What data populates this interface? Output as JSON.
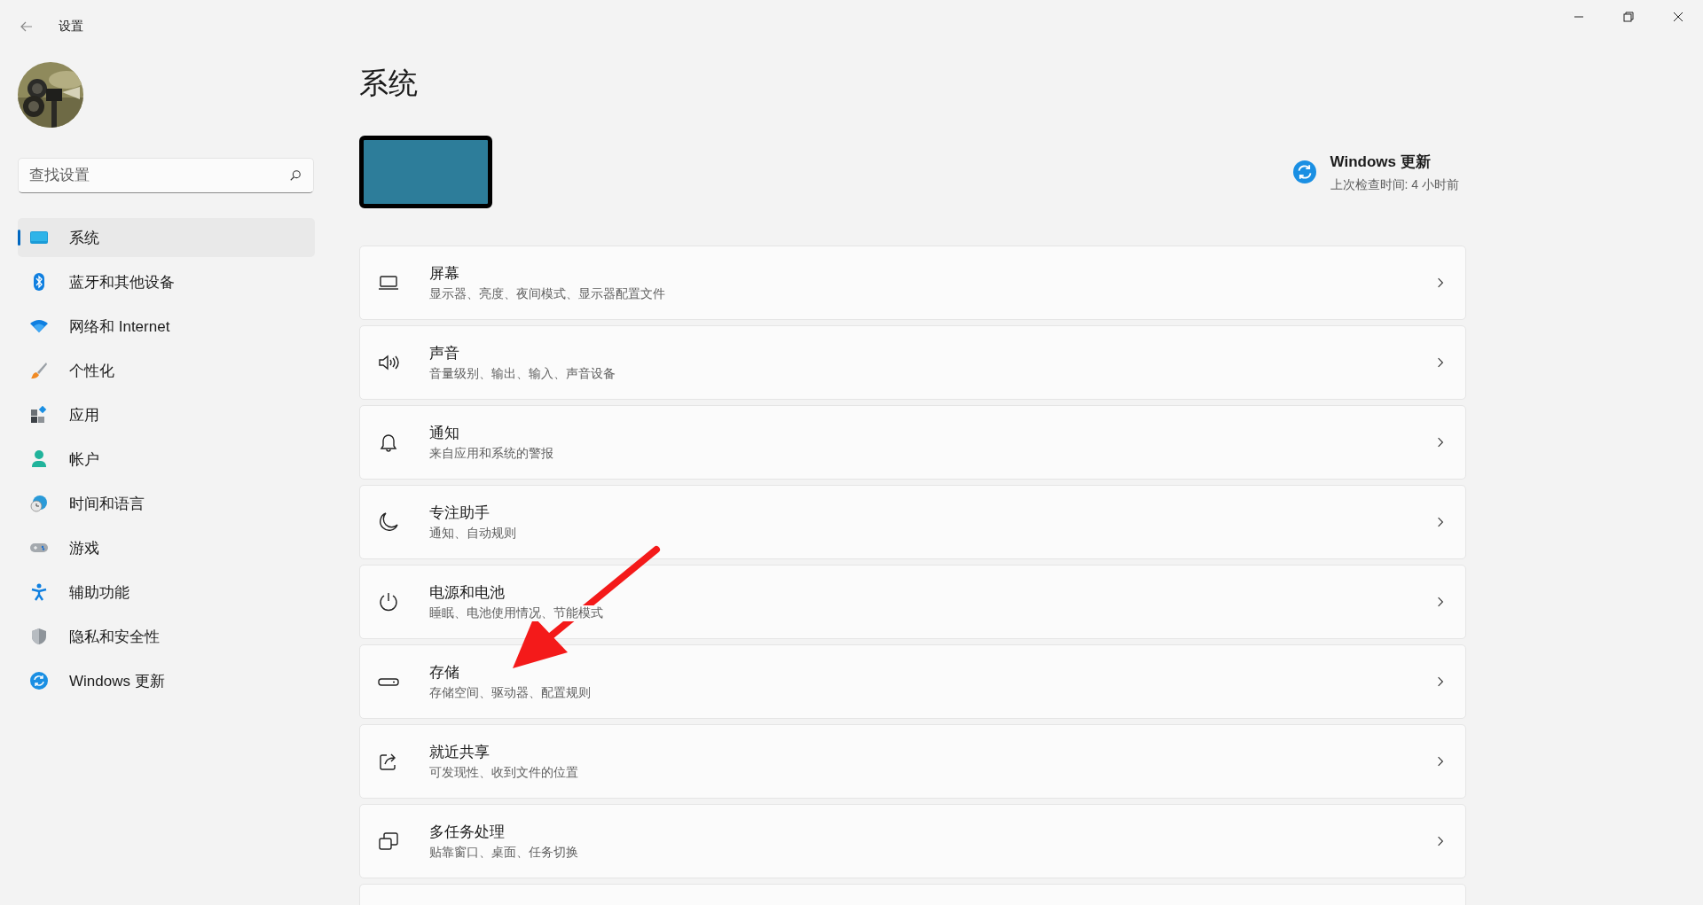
{
  "window": {
    "title": "设置"
  },
  "search": {
    "placeholder": "查找设置"
  },
  "nav": [
    {
      "label": "系统",
      "selected": true
    },
    {
      "label": "蓝牙和其他设备",
      "selected": false
    },
    {
      "label": "网络和 Internet",
      "selected": false
    },
    {
      "label": "个性化",
      "selected": false
    },
    {
      "label": "应用",
      "selected": false
    },
    {
      "label": "帐户",
      "selected": false
    },
    {
      "label": "时间和语言",
      "selected": false
    },
    {
      "label": "游戏",
      "selected": false
    },
    {
      "label": "辅助功能",
      "selected": false
    },
    {
      "label": "隐私和安全性",
      "selected": false
    },
    {
      "label": "Windows 更新",
      "selected": false
    }
  ],
  "page_title": "系统",
  "update": {
    "title": "Windows 更新",
    "subtitle": "上次检查时间: 4 小时前"
  },
  "cards": [
    {
      "title": "屏幕",
      "subtitle": "显示器、亮度、夜间模式、显示器配置文件"
    },
    {
      "title": "声音",
      "subtitle": "音量级别、输出、输入、声音设备"
    },
    {
      "title": "通知",
      "subtitle": "来自应用和系统的警报"
    },
    {
      "title": "专注助手",
      "subtitle": "通知、自动规则"
    },
    {
      "title": "电源和电池",
      "subtitle": "睡眠、电池使用情况、节能模式"
    },
    {
      "title": "存储",
      "subtitle": "存储空间、驱动器、配置规则"
    },
    {
      "title": "就近共享",
      "subtitle": "可发现性、收到文件的位置"
    },
    {
      "title": "多任务处理",
      "subtitle": "贴靠窗口、桌面、任务切换"
    }
  ],
  "annotation": {
    "kind": "arrow"
  }
}
